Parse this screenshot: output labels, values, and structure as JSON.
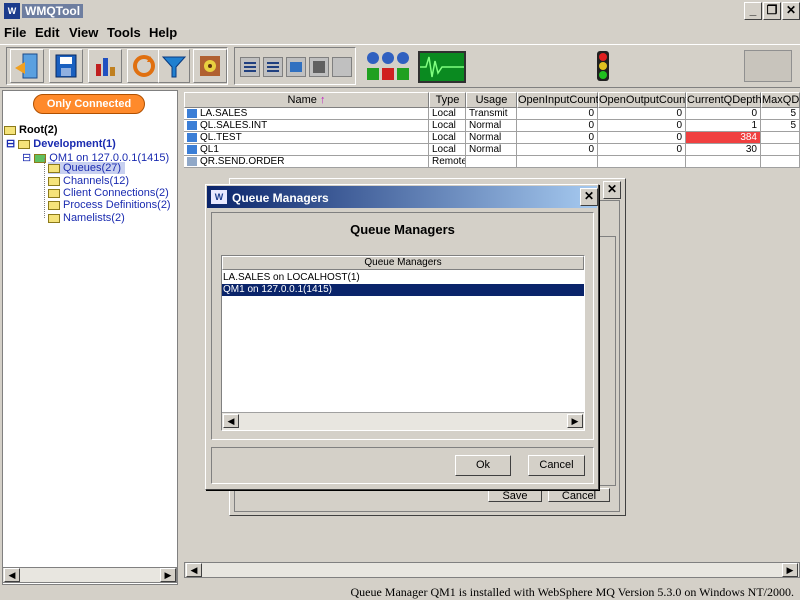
{
  "window": {
    "title": "WMQTool",
    "icon_label": "W"
  },
  "menu": [
    "File",
    "Edit",
    "View",
    "Tools",
    "Help"
  ],
  "toolbar_icons": [
    "exit-icon",
    "save-icon",
    "chart-icon",
    "refresh-icon",
    "filter-icon",
    "settings-icon",
    "list-icon",
    "list2-icon",
    "list3-icon",
    "disk-icon",
    "blank-icon",
    "status-lights-icon",
    "monitor-icon",
    "traffic-light-icon",
    "panel-icon"
  ],
  "left": {
    "only_connected": "Only Connected",
    "tree": {
      "root": "Root(2)",
      "development": "Development(1)",
      "qm1": "QM1  on 127.0.0.1(1415)",
      "queues": "Queues(27)",
      "channels": "Channels(12)",
      "client_connections": "Client Connections(2)",
      "process_definitions": "Process Definitions(2)",
      "namelists": "Namelists(2)"
    }
  },
  "table": {
    "headers": [
      "Name",
      "Type",
      "Usage",
      "OpenInputCount",
      "OpenOutputCount",
      "CurrentQDepth",
      "MaxQDe"
    ],
    "sort_arrow": "↑",
    "rows": [
      {
        "name": "LA.SALES",
        "type": "Local",
        "usage": "Transmit",
        "in": "0",
        "out": "0",
        "depth": "0",
        "max": "5"
      },
      {
        "name": "QL.SALES.INT",
        "type": "Local",
        "usage": "Normal",
        "in": "0",
        "out": "0",
        "depth": "1",
        "max": "5"
      },
      {
        "name": "QL.TEST",
        "type": "Local",
        "usage": "Normal",
        "in": "0",
        "out": "0",
        "depth": "384",
        "max": ""
      },
      {
        "name": "QL1",
        "type": "Local",
        "usage": "Normal",
        "in": "0",
        "out": "0",
        "depth": "30",
        "max": ""
      },
      {
        "name": "QR.SEND.ORDER",
        "type": "Remote",
        "usage": "",
        "in": "",
        "out": "",
        "depth": "",
        "max": ""
      }
    ]
  },
  "background_dialog": {
    "save": "Save",
    "cancel": "Cancel",
    "close": "✕"
  },
  "dialog": {
    "title": "Queue Managers",
    "heading": "Queue Managers",
    "list_header": "Queue Managers",
    "items": [
      "LA.SALES  on LOCALHOST(1)",
      "QM1  on 127.0.0.1(1415)"
    ],
    "selected_index": 1,
    "ok": "Ok",
    "cancel": "Cancel",
    "close": "✕"
  },
  "status": "Queue Manager QM1  is installed with WebSphere MQ Version 5.3.0 on Windows NT/2000.",
  "colors": {
    "highlight_cell": "#f04040",
    "selection": "#0a246a",
    "only_connected": "#ff8a2b"
  }
}
